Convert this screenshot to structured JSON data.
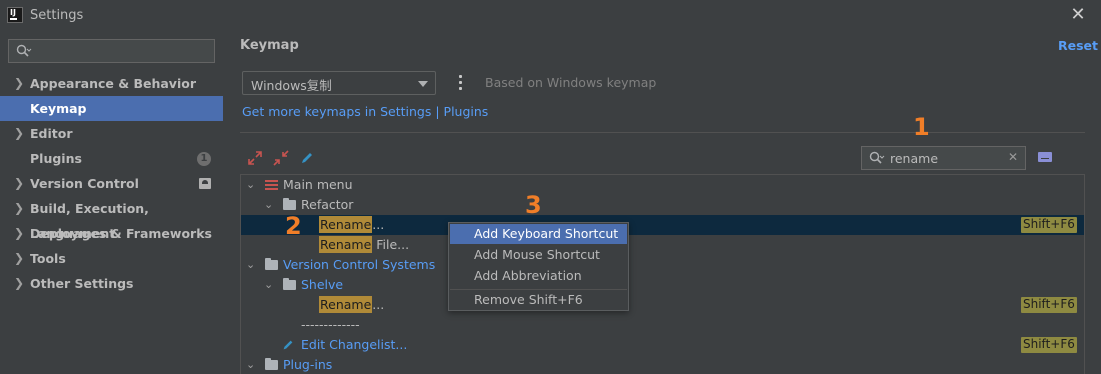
{
  "window": {
    "title": "Settings",
    "app_icon_text": "IJ",
    "close_glyph": "✕"
  },
  "sidebar": {
    "search_placeholder": "",
    "items": [
      {
        "label": "Appearance & Behavior",
        "expandable": true
      },
      {
        "label": "Keymap",
        "selected": true
      },
      {
        "label": "Editor",
        "expandable": true
      },
      {
        "label": "Plugins",
        "badge": "1"
      },
      {
        "label": "Version Control",
        "expandable": true,
        "icon": "repo-icon"
      },
      {
        "label": "Build, Execution, Deployment",
        "expandable": true
      },
      {
        "label": "Languages & Frameworks",
        "expandable": true
      },
      {
        "label": "Tools",
        "expandable": true
      },
      {
        "label": "Other Settings",
        "expandable": true
      }
    ]
  },
  "main": {
    "heading": "Keymap",
    "reset": "Reset",
    "keymap_select": "Windows复制",
    "based_on": "Based on Windows keymap",
    "link": "Get more keymaps in Settings | Plugins",
    "search": {
      "value": "rename",
      "placeholder": ""
    },
    "toolbar_icons": [
      "expand-all-icon",
      "collapse-all-icon",
      "edit-pencil-icon"
    ]
  },
  "tree": {
    "rows": [
      {
        "text": "Main menu"
      },
      {
        "text": "Refactor"
      },
      {
        "hl": "Rename",
        "rest": "...",
        "shortcut": "Shift+F6"
      },
      {
        "hl": "Rename",
        "rest": " File..."
      },
      {
        "text": "Version Control Systems"
      },
      {
        "text": "Shelve"
      },
      {
        "hl": "Rename",
        "rest": "...",
        "shortcut": "Shift+F6"
      },
      {
        "text": "-------------"
      },
      {
        "text": "Edit Changelist...",
        "shortcut": "Shift+F6"
      },
      {
        "text": "Plug-ins"
      }
    ]
  },
  "context_menu": {
    "items": [
      "Add Keyboard Shortcut",
      "Add Mouse Shortcut",
      "Add Abbreviation",
      "Remove Shift+F6"
    ]
  },
  "annotations": [
    "1",
    "2",
    "3"
  ],
  "colors": {
    "selection": "#4b6eaf",
    "tree_selection": "#0d293e",
    "link": "#589df6",
    "highlight": "#b08a38",
    "shortcut_bg": "#8e8a41",
    "annotation": "#f07e28"
  }
}
